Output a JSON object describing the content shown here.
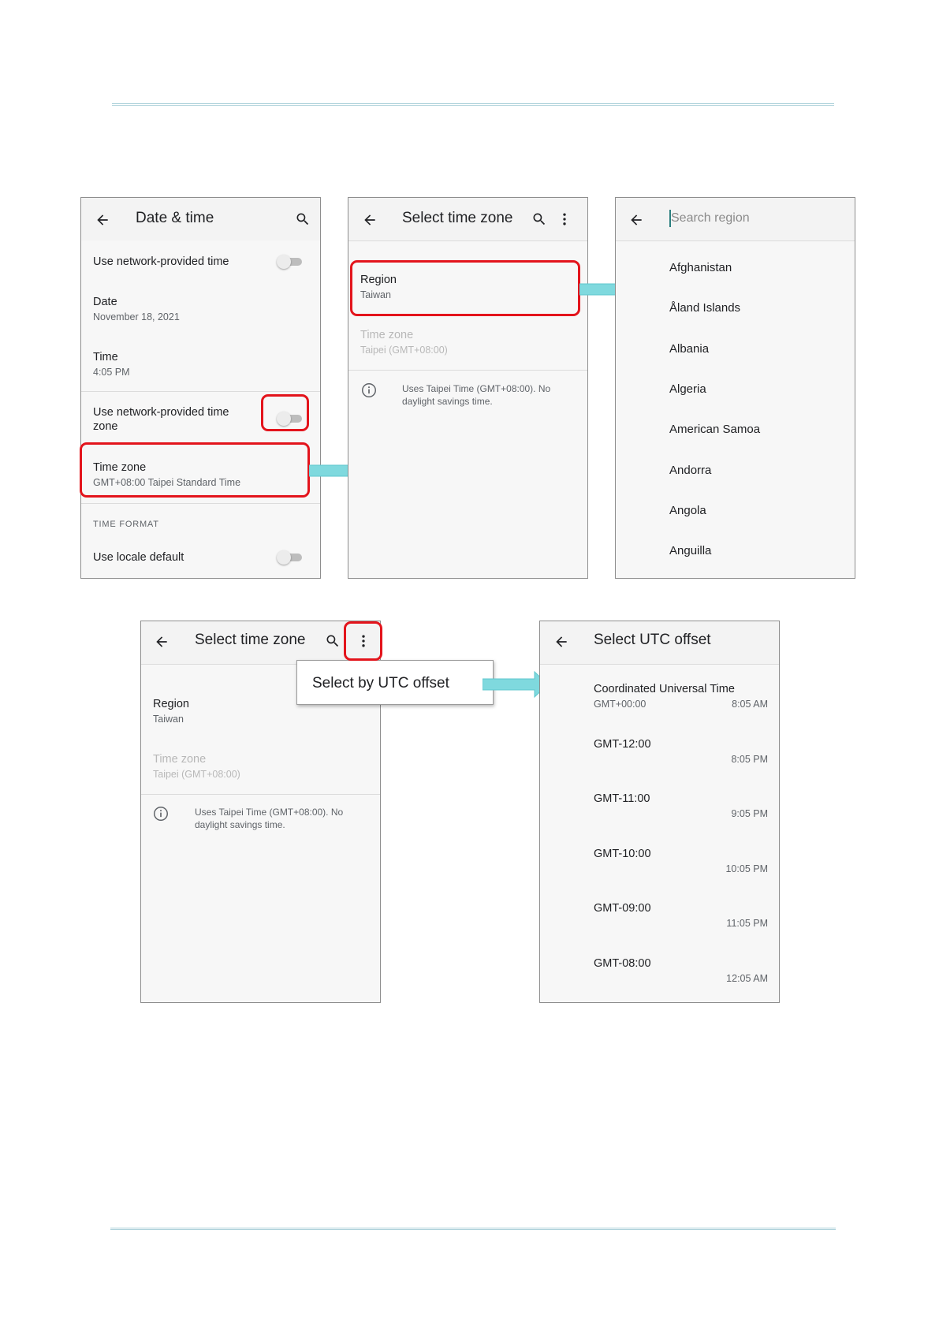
{
  "screen1": {
    "title": "Date & time",
    "auto_time_label": "Use network-provided time",
    "date_label": "Date",
    "date_value": "November 18, 2021",
    "time_label": "Time",
    "time_value": "4:05 PM",
    "auto_zone_label_line1": "Use network-provided time",
    "auto_zone_label_line2": "zone",
    "timezone_label": "Time zone",
    "timezone_value": "GMT+08:00 Taipei Standard Time",
    "section_time_format": "TIME FORMAT",
    "locale_label": "Use locale default"
  },
  "screen2": {
    "title": "Select time zone",
    "region_label": "Region",
    "region_value": "Taiwan",
    "timezone_label": "Time zone",
    "timezone_value": "Taipei (GMT+08:00)",
    "info_line1": "Uses Taipei Time (GMT+08:00). No",
    "info_line2": "daylight savings time."
  },
  "screen3": {
    "search_placeholder": "Search region",
    "regions": [
      "Afghanistan",
      "Åland Islands",
      "Albania",
      "Algeria",
      "American Samoa",
      "Andorra",
      "Angola",
      "Anguilla"
    ]
  },
  "screen4": {
    "title": "Select time zone",
    "menu_item": "Select by UTC offset",
    "region_label": "Region",
    "region_value": "Taiwan",
    "timezone_label": "Time zone",
    "timezone_value": "Taipei (GMT+08:00)",
    "info_line1": "Uses Taipei Time (GMT+08:00). No",
    "info_line2": "daylight savings time."
  },
  "screen5": {
    "title": "Select UTC offset",
    "offsets": [
      {
        "name": "Coordinated Universal Time",
        "sub": "GMT+00:00",
        "time": "8:05 AM"
      },
      {
        "name": "GMT-12:00",
        "time": "8:05 PM"
      },
      {
        "name": "GMT-11:00",
        "time": "9:05 PM"
      },
      {
        "name": "GMT-10:00",
        "time": "10:05 PM"
      },
      {
        "name": "GMT-09:00",
        "time": "11:05 PM"
      },
      {
        "name": "GMT-08:00",
        "time": "12:05 AM"
      }
    ]
  },
  "colors": {
    "highlight": "#e3141c",
    "arrow": "#7fd9de",
    "rule": "#a9cfd8"
  },
  "icons": [
    "back-arrow-icon",
    "search-icon",
    "more-vert-icon",
    "info-icon",
    "toggle-switch",
    "right-arrow-icon"
  ]
}
